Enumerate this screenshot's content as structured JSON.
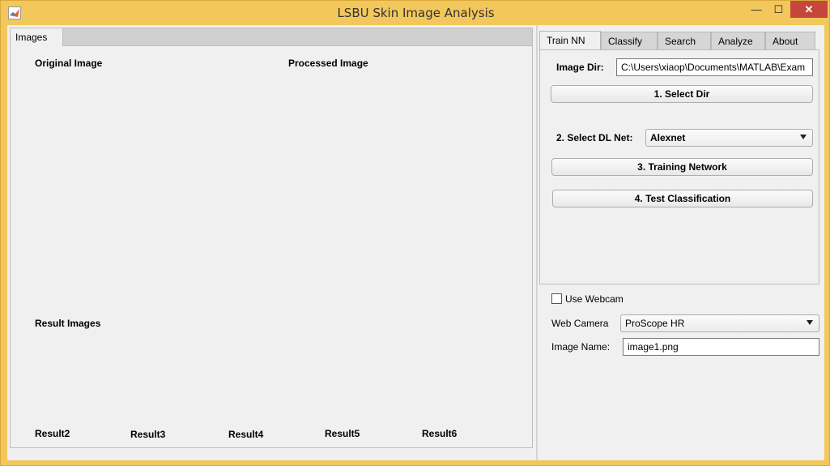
{
  "window": {
    "title": "LSBU Skin Image Analysis",
    "minimize_glyph": "—",
    "maximize_glyph": "☐",
    "close_glyph": "✕",
    "app_icon": "matlab-icon"
  },
  "left_tabs": {
    "active_tab": "Images",
    "original_image_label": "Original Image",
    "processed_image_label": "Processed Image",
    "result_images_label": "Result Images",
    "results": [
      "Result2",
      "Result3",
      "Result4",
      "Result5",
      "Result6"
    ]
  },
  "right_tabs": {
    "tabs": [
      "Train NN",
      "Classify",
      "Search",
      "Analyze",
      "About"
    ],
    "active_tab": "Train NN"
  },
  "train_nn": {
    "image_dir_label": "Image Dir:",
    "image_dir_value": "C:\\Users\\xiaop\\Documents\\MATLAB\\Exam",
    "select_dir_button": "1. Select Dir",
    "select_dl_net_label": "2. Select DL Net:",
    "dl_net_selected": "Alexnet",
    "training_button": "3. Training Network",
    "test_button": "4. Test Classification"
  },
  "webcam": {
    "use_webcam_label": "Use Webcam",
    "use_webcam_checked": false,
    "web_camera_label": "Web Camera",
    "web_camera_selected": "ProScope HR",
    "image_name_label": "Image Name:",
    "image_name_value": "image1.png"
  }
}
